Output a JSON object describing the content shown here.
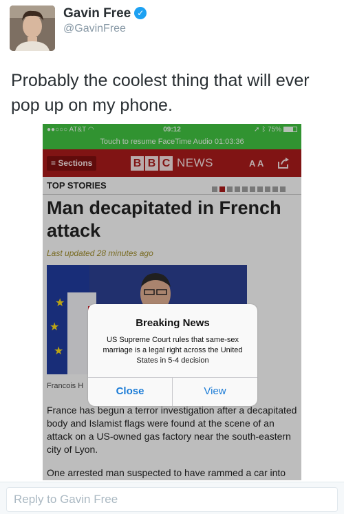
{
  "tweet": {
    "display_name": "Gavin Free",
    "handle": "@GavinFree",
    "verified_icon": "verified-checkmark-icon",
    "text": "Probably the coolest thing that will ever pop up on my phone."
  },
  "phone": {
    "status": {
      "carrier": "AT&T",
      "time": "09:12",
      "battery": "75%",
      "facetime_banner": "Touch to resume FaceTime Audio 01:03:36"
    },
    "bbc_bar": {
      "sections_label": "≡ Sections",
      "logo_letters": [
        "B",
        "B",
        "C"
      ],
      "logo_news": "NEWS",
      "text_size_label": "A A"
    },
    "top_stories_label": "TOP STORIES",
    "headline": "Man decapitated in French attack",
    "last_updated": "Last updated 28 minutes ago",
    "photo_caption": "Francois H",
    "body_paragraph_1": "France has begun a terror investigation after a decapitated body and Islamist flags were found at the scene of an attack on a US-owned gas factory near the south-eastern city of Lyon.",
    "body_paragraph_2": "One arrested man suspected to have rammed a car into",
    "alert": {
      "title": "Breaking News",
      "message": "US Supreme Court rules that same-sex marriage is a legal right across the United States in 5-4 decision",
      "close_label": "Close",
      "view_label": "View",
      "button_color": "#1a7bd6"
    },
    "colors": {
      "status_green": "#3fbd3f",
      "bbc_red": "#a51a1a"
    }
  },
  "reply": {
    "placeholder": "Reply to Gavin Free"
  }
}
